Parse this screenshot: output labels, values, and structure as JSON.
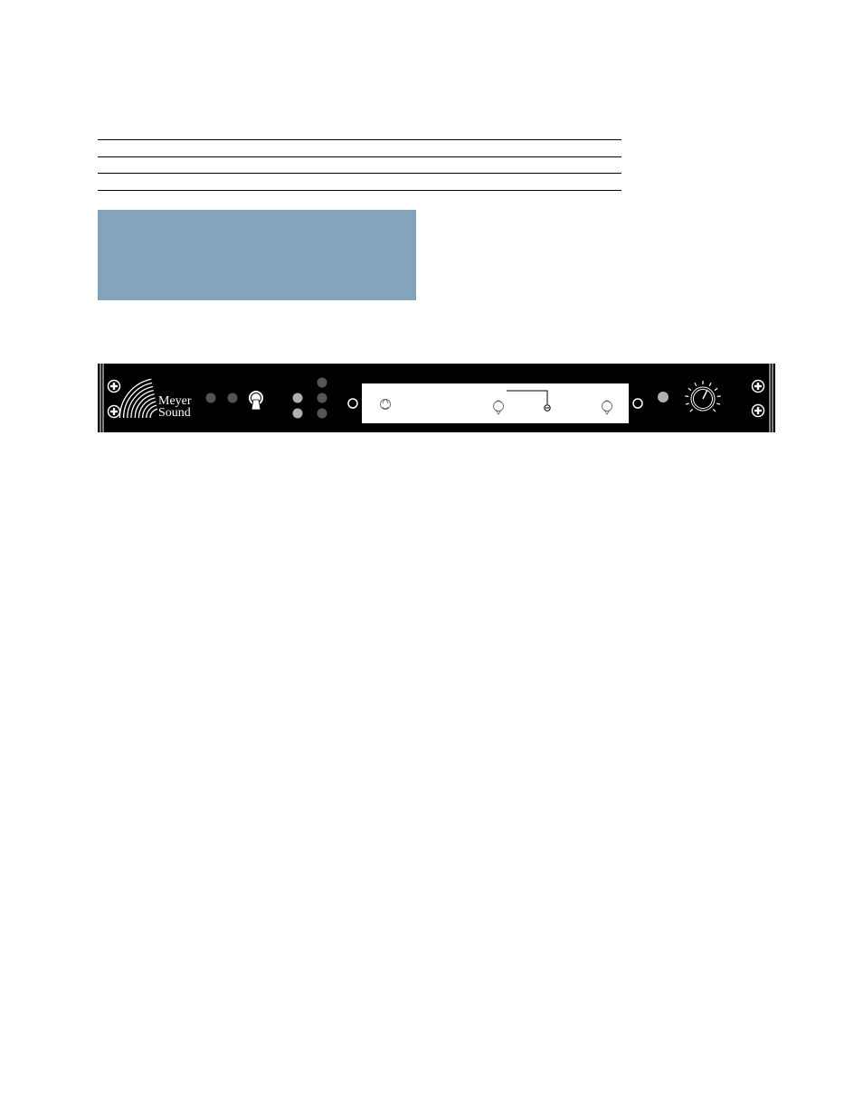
{
  "document": {
    "table_rules": 4,
    "note_box": {
      "text": "",
      "color": "#84a4bb"
    }
  },
  "front_panel": {
    "brand": {
      "line1": "Meyer",
      "line2": "Sound"
    },
    "colors": {
      "panel": "#000000",
      "led_dark": "#555555",
      "led_light": "#b0b0b0",
      "window": "#ffffff"
    },
    "leds_left": [
      "off",
      "off"
    ],
    "leds_matrix": [
      [
        "none",
        "off"
      ],
      [
        "on",
        "off"
      ],
      [
        "on",
        "off"
      ]
    ],
    "led_right": "on",
    "knob_level": 0.6
  }
}
